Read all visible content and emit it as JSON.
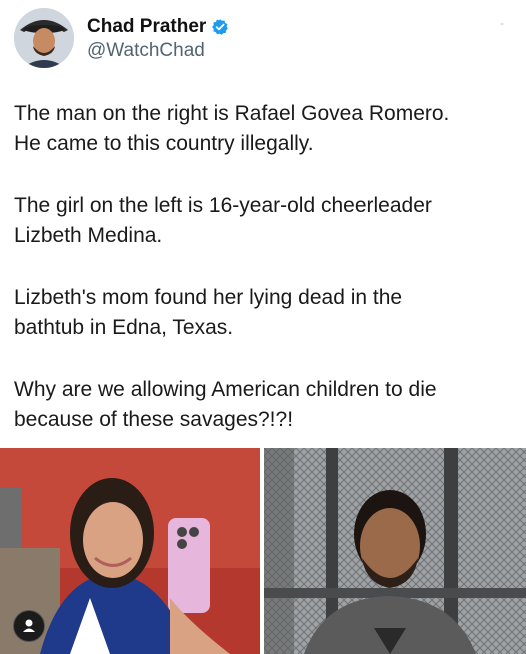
{
  "author": {
    "name": "Chad Prather",
    "handle": "@WatchChad",
    "verified": true,
    "avatar_icon": "profile-photo"
  },
  "post": {
    "paragraphs": [
      "The man on the right is Rafael Govea Romero.\nHe came to this country illegally.",
      "The girl on the left is 16-year-old cheerleader\nLizbeth Medina.",
      "Lizbeth's mom found her lying dead in the\nbathtub in Edna, Texas.",
      "Why are we allowing American children to die\nbecause of these savages?!?!"
    ]
  },
  "media": {
    "left_photo_icon": "photo-girl-selfie",
    "right_photo_icon": "photo-man-mugshot",
    "badge_icon": "user-icon"
  },
  "colors": {
    "verified_blue": "#1d9bf0",
    "handle_gray": "#536471",
    "text": "#1a1a1a"
  }
}
